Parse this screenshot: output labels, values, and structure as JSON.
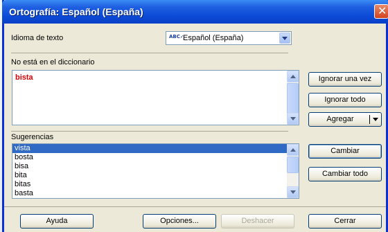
{
  "window": {
    "title": "Ortografía: Español (España)"
  },
  "language": {
    "label": "Idioma de texto",
    "selected": "Español (España)",
    "icon": "spellcheck-abc-icon"
  },
  "not_in_dictionary": {
    "label": "No está en el diccionario",
    "word": "bista"
  },
  "suggestions": {
    "label": "Sugerencias",
    "items": [
      "vista",
      "bosta",
      "bisa",
      "bita",
      "bitas",
      "basta"
    ],
    "selected_index": 0
  },
  "side_buttons": {
    "ignore_once": "Ignorar una vez",
    "ignore_all": "Ignorar todo",
    "add": "Agregar",
    "change": "Cambiar",
    "change_all": "Cambiar todo"
  },
  "bottom_buttons": {
    "help": "Ayuda",
    "options": "Opciones...",
    "undo": "Deshacer",
    "close": "Cerrar"
  },
  "colors": {
    "title_bar": "#0b4ad6",
    "misspelled": "#e00000",
    "selection": "#316ac5"
  }
}
